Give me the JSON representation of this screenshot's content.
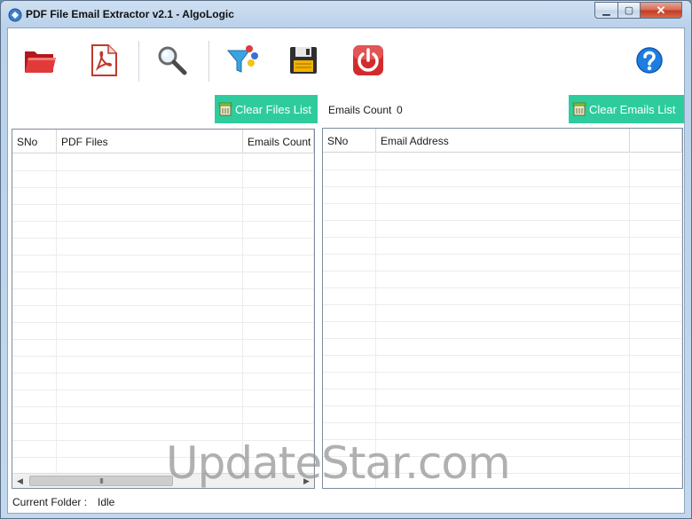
{
  "window": {
    "title": "PDF File Email Extractor v2.1 - AlgoLogic",
    "controls": {
      "minimize": "▁",
      "maximize": "▢",
      "close": "✕"
    }
  },
  "toolbar": {
    "items": [
      {
        "name": "open-folder-button",
        "icon": "red-folder-icon"
      },
      {
        "name": "add-pdf-button",
        "icon": "pdf-file-icon"
      },
      {
        "name": "search-button",
        "icon": "magnifier-icon"
      },
      {
        "name": "filter-button",
        "icon": "funnel-icon"
      },
      {
        "name": "save-button",
        "icon": "floppy-disk-icon"
      },
      {
        "name": "exit-button",
        "icon": "power-icon"
      },
      {
        "name": "help-button",
        "icon": "help-icon"
      }
    ]
  },
  "controls": {
    "clear_files_label": "Clear Files List",
    "emails_count_label": "Emails Count",
    "emails_count_value": "0",
    "clear_emails_label": "Clear Emails List"
  },
  "files_grid": {
    "columns": [
      "SNo",
      "PDF Files",
      "Emails Count"
    ],
    "rows": []
  },
  "emails_grid": {
    "columns": [
      "SNo",
      "Email Address"
    ],
    "rows": []
  },
  "scrollbar": {
    "left_arrow": "◀",
    "right_arrow": "▶",
    "grip": "III"
  },
  "status": {
    "label": "Current Folder :",
    "value": "Idle"
  },
  "watermark": "UpdateStar.com",
  "colors": {
    "accent_green": "#2ecc9c",
    "titlebar": "#c3d8ee"
  }
}
